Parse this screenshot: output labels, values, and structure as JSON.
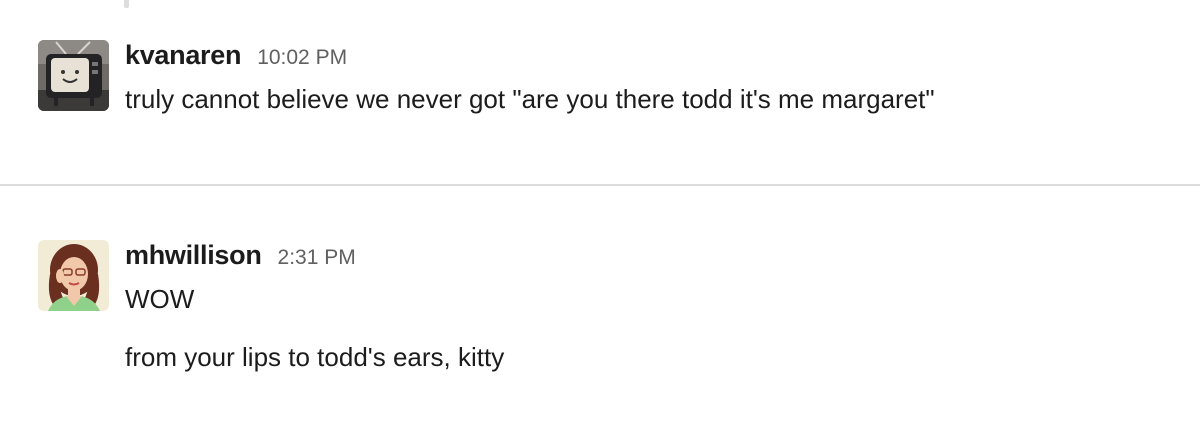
{
  "messages": [
    {
      "username": "kvanaren",
      "time": "10:02 PM",
      "avatar_icon": "tv-avatar-icon",
      "lines": [
        "truly cannot believe we never got \"are you there todd it's me margaret\""
      ]
    },
    {
      "username": "mhwillison",
      "time": "2:31 PM",
      "avatar_icon": "person-avatar-icon",
      "lines": [
        "WOW",
        "from your lips to todd's ears, kitty"
      ]
    }
  ],
  "colors": {
    "text": "#1d1c1d",
    "timestamp": "#616061",
    "divider": "#dddddd"
  }
}
